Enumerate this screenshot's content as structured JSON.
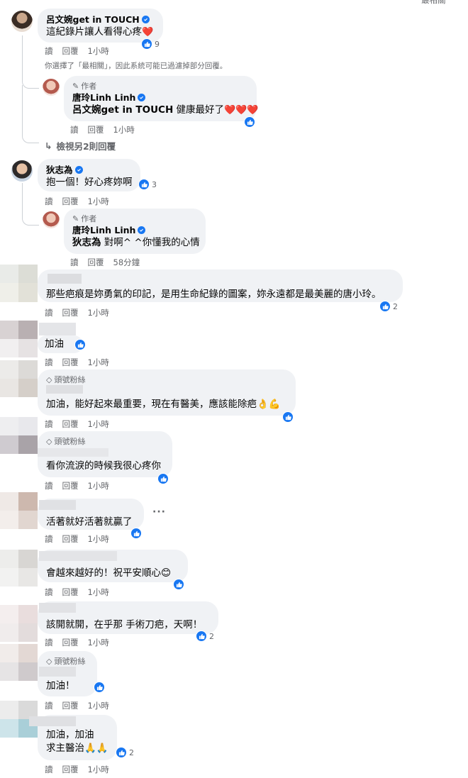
{
  "labels": {
    "read": "讀",
    "reply": "回覆",
    "author": "作者",
    "top_fan": "頭號粉絲"
  },
  "top_fragment": "最相關",
  "filter_note": "你選擇了「最相關」，因此系統可能已過濾掉部分回覆。",
  "view_more": "檢視另2則回覆",
  "colors": {
    "like_blue": "#1877f2",
    "bubble": "#f0f2f5",
    "secondary_text": "#65676b",
    "heart": "#f02849"
  },
  "comments": [
    {
      "name": "呂文婉get in TOUCH",
      "text": "這紀錄片讓人看得心疼",
      "emoji": "❤️",
      "time": "1小時",
      "reactions": "9"
    },
    {
      "name": "唐玲Linh Linh",
      "mention": "呂文婉get in TOUCH",
      "text": " 健康最好了",
      "emoji": "❤️❤️❤️",
      "time": "1小時"
    },
    {
      "name": "狄志為",
      "text": "抱一個！好心疼妳啊",
      "time": "1小時",
      "reactions": "3"
    },
    {
      "name": "唐玲Linh Linh",
      "mention": "狄志為",
      "text": " 對啊^ ^你懂我的心情",
      "time": "58分鐘"
    },
    {
      "text": "那些疤痕是妳勇氣的印記，是用生命紀錄的圖案，妳永遠都是最美麗的唐小玲。",
      "time": "1小時",
      "reactions": "2"
    },
    {
      "text": "加油",
      "time": "1小時"
    },
    {
      "text": "加油，能好起來最重要，現在有醫美，應該能除疤",
      "emoji": "👌💪",
      "time": "1小時"
    },
    {
      "text": "看你流淚的時候我很心疼你",
      "time": "1小時"
    },
    {
      "text": "活著就好活著就贏了",
      "time": "1小時"
    },
    {
      "text": "會越來越好的！祝平安順心",
      "emoji": "😊",
      "time": "1小時"
    },
    {
      "text": "該開就開，在乎那 手術刀疤，天啊！",
      "time": "1小時",
      "reactions": "2"
    },
    {
      "text": "加油！",
      "time": "1小時"
    },
    {
      "text": "加油，加油",
      "text2": "求主醫治",
      "emoji": "🙏🙏",
      "time": "1小時",
      "reactions": "2"
    }
  ]
}
